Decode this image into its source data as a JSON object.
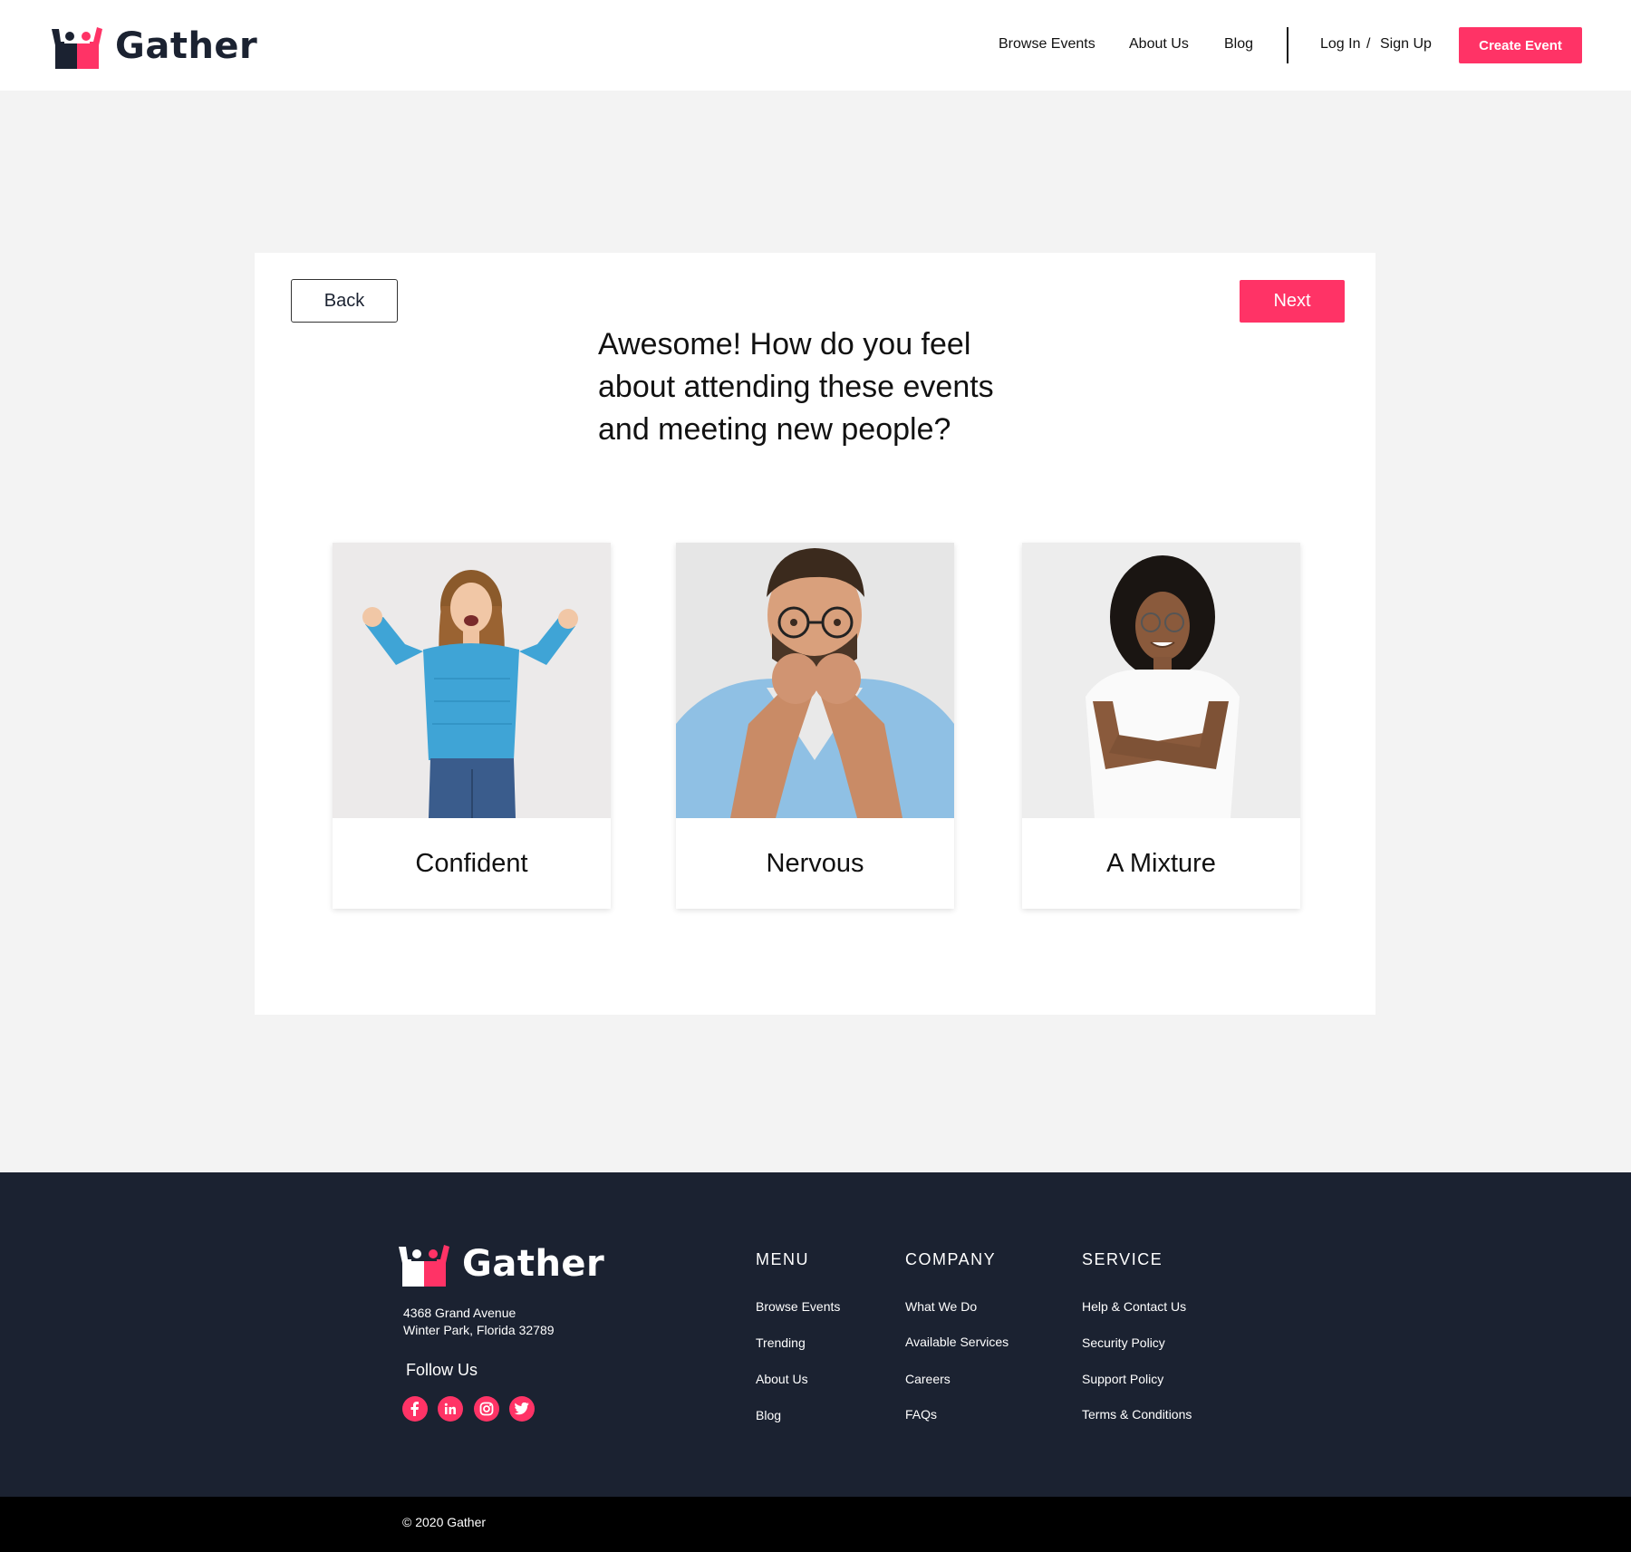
{
  "brand": {
    "name": "Gather",
    "accent": "#ff3366",
    "dark": "#1b2231"
  },
  "nav": {
    "browse": "Browse Events",
    "about": "About Us",
    "blog": "Blog",
    "login": "Log In",
    "separator": "/",
    "signup": "Sign Up",
    "create": "Create Event"
  },
  "question": {
    "back": "Back",
    "next": "Next",
    "text": "Awesome! How do you feel about attending these events and meeting new people?",
    "options": [
      {
        "label": "Confident",
        "image": "woman-celebrating-photo"
      },
      {
        "label": "Nervous",
        "image": "man-biting-fists-photo"
      },
      {
        "label": "A Mixture",
        "image": "woman-arms-crossed-photo"
      }
    ]
  },
  "footer": {
    "address_line1": "4368 Grand Avenue",
    "address_line2": "Winter Park, Florida 32789",
    "follow": "Follow Us",
    "social": [
      "facebook-icon",
      "linkedin-icon",
      "instagram-icon",
      "twitter-icon"
    ],
    "menu": {
      "title": "MENU",
      "items": [
        "Browse Events",
        "Trending",
        "About Us",
        "Blog"
      ]
    },
    "company": {
      "title": "COMPANY",
      "items": [
        "What We Do",
        "Available Services",
        "Careers",
        "FAQs"
      ]
    },
    "service": {
      "title": "SERVICE",
      "items": [
        "Help & Contact Us",
        "Security Policy",
        "Support Policy",
        "Terms & Conditions"
      ]
    },
    "copyright": "© 2020 Gather"
  }
}
